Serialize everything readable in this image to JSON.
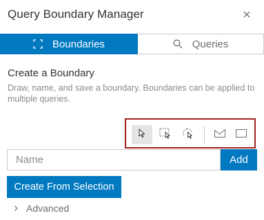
{
  "header": {
    "title": "Query Boundary Manager",
    "close_icon": "close-icon"
  },
  "tabs": [
    {
      "label": "Boundaries",
      "icon": "boundary-select-icon",
      "active": true
    },
    {
      "label": "Queries",
      "icon": "search-icon",
      "active": false
    }
  ],
  "section": {
    "title": "Create a Boundary",
    "description": "Draw, name, and save a boundary. Boundaries can be applied to multiple queries."
  },
  "toolbar": {
    "tools": [
      {
        "icon": "pointer-select-icon",
        "selected": true
      },
      {
        "icon": "rectangle-select-icon",
        "selected": false
      },
      {
        "icon": "lasso-select-icon",
        "selected": false
      },
      {
        "icon": "polygon-draw-icon",
        "selected": false
      },
      {
        "icon": "rectangle-draw-icon",
        "selected": false
      }
    ],
    "highlight_color": "#a5201f"
  },
  "name_field": {
    "placeholder": "Name",
    "value": ""
  },
  "add_button": {
    "label": "Add"
  },
  "create_button": {
    "label": "Create From Selection"
  },
  "advanced": {
    "label": "Advanced",
    "icon": "chevron-right-icon"
  },
  "colors": {
    "accent": "#0079c1",
    "text": "#323232",
    "muted": "#8a8a8a"
  }
}
